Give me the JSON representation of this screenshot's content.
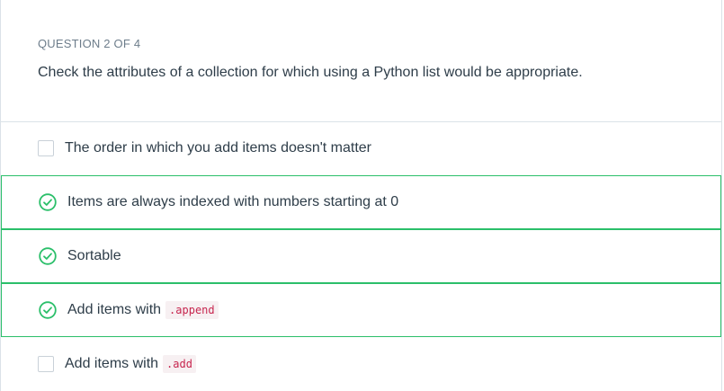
{
  "question": {
    "number": "QUESTION 2 OF 4",
    "text": "Check the attributes of a collection for which using a Python list would be appropriate."
  },
  "colors": {
    "checked_border": "#2bbf6a",
    "code_text": "#c7254e"
  },
  "options": [
    {
      "label": "The order in which you add items doesn't matter",
      "code": "",
      "checked": false
    },
    {
      "label": "Items are always indexed with numbers starting at 0",
      "code": "",
      "checked": true
    },
    {
      "label": "Sortable",
      "code": "",
      "checked": true
    },
    {
      "label": "Add items with",
      "code": ".append",
      "checked": true
    },
    {
      "label": "Add items with",
      "code": ".add",
      "checked": false
    }
  ]
}
